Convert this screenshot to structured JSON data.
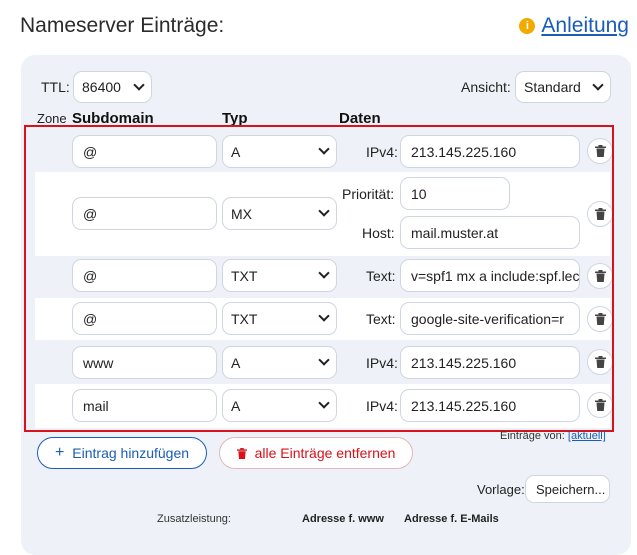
{
  "title": "Nameserver Einträge:",
  "help": {
    "label": "Anleitung",
    "icon": "info-icon"
  },
  "toolbar": {
    "ttl_label": "TTL:",
    "ttl_value": "86400",
    "view_label": "Ansicht:",
    "view_value": "Standard"
  },
  "headers": {
    "zone": "Zone",
    "subdomain": "Subdomain",
    "type": "Typ",
    "data": "Daten"
  },
  "records": [
    {
      "subdomain": "@",
      "type": "A",
      "fields": [
        {
          "label": "IPv4:",
          "value": "213.145.225.160"
        }
      ]
    },
    {
      "subdomain": "@",
      "type": "MX",
      "fields": [
        {
          "label": "Priorität:",
          "value": "10"
        },
        {
          "label": "Host:",
          "value": "mail.muster.at"
        }
      ]
    },
    {
      "subdomain": "@",
      "type": "TXT",
      "fields": [
        {
          "label": "Text:",
          "value": "v=spf1 mx a include:spf.lec"
        }
      ]
    },
    {
      "subdomain": "@",
      "type": "TXT",
      "fields": [
        {
          "label": "Text:",
          "value": "google-site-verification=r"
        }
      ]
    },
    {
      "subdomain": "www",
      "type": "A",
      "fields": [
        {
          "label": "IPv4:",
          "value": "213.145.225.160"
        }
      ]
    },
    {
      "subdomain": "mail",
      "type": "A",
      "fields": [
        {
          "label": "IPv4:",
          "value": "213.145.225.160"
        }
      ]
    }
  ],
  "entries_from": {
    "label": "Einträge von:",
    "link": "[aktuell]"
  },
  "actions": {
    "add_label": "Eintrag hinzufügen",
    "remove_label": "alle Einträge entfernen"
  },
  "template": {
    "label": "Vorlage:",
    "button": "Speichern..."
  },
  "extra": {
    "label": "Zusatzleistung:",
    "col_www": "Adresse f. www",
    "col_mail": "Adresse f. E-Mails"
  },
  "colors": {
    "accent": "#1a5cb8",
    "danger": "#d9111a",
    "panel": "#eef2f8"
  }
}
